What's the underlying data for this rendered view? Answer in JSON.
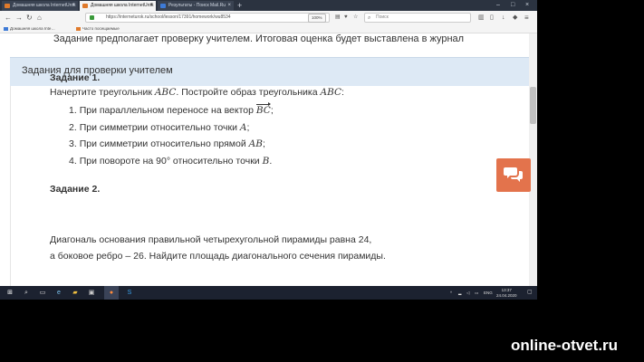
{
  "browser": {
    "tabs": [
      {
        "label": "Домашняя школа InternetUrok",
        "active": false
      },
      {
        "label": "Домашняя школа InternetUrok",
        "active": true
      },
      {
        "label": "Результаты - Поиск Mail.Ru",
        "active": false
      }
    ],
    "url": "https://interneturok.ru/school/lesson/17391/homework/wu8534",
    "zoom": "100%",
    "search_placeholder": "Поиск",
    "bookmarks": [
      "Домашняя школа Inte…",
      "Часто посещаемые"
    ]
  },
  "page": {
    "top_line": "Задание предполагает проверку учителем. Итоговая оценка будет выставлена в журнал",
    "section_title": "Задания для проверки учителем",
    "task1": {
      "title": "Задание 1.",
      "desc_prefix": "Начертите треугольник",
      "desc_mid": ". Постройте образ треугольника",
      "tri": "ABC",
      "desc_end": ":",
      "items": [
        {
          "num": "1.",
          "text": "При параллельном переносе на вектор",
          "math": "BC",
          "end": ";"
        },
        {
          "num": "2.",
          "text": "При симметрии относительно точки",
          "math": "A",
          "end": ";"
        },
        {
          "num": "3.",
          "text": "При симметрии относительно прямой",
          "math": "AB",
          "end": ";"
        },
        {
          "num": "4.",
          "text": "При повороте на 90° относительно точки",
          "math": "B",
          "end": "."
        }
      ]
    },
    "task2": {
      "title": "Задание 2.",
      "line1": "Диагональ основания правильной четырехугольной пирамиды равна 24,",
      "line2": "а боковое ребро – 26. Найдите площадь диагонального сечения пирамиды."
    }
  },
  "taskbar": {
    "lang": "ENG",
    "time": "13:37",
    "date": "24.04.2020"
  },
  "watermark": "online-otvet.ru",
  "colors": {
    "section_bg": "#dde9f5",
    "chat_button": "#e3734c",
    "taskbar": "#1c2230"
  }
}
